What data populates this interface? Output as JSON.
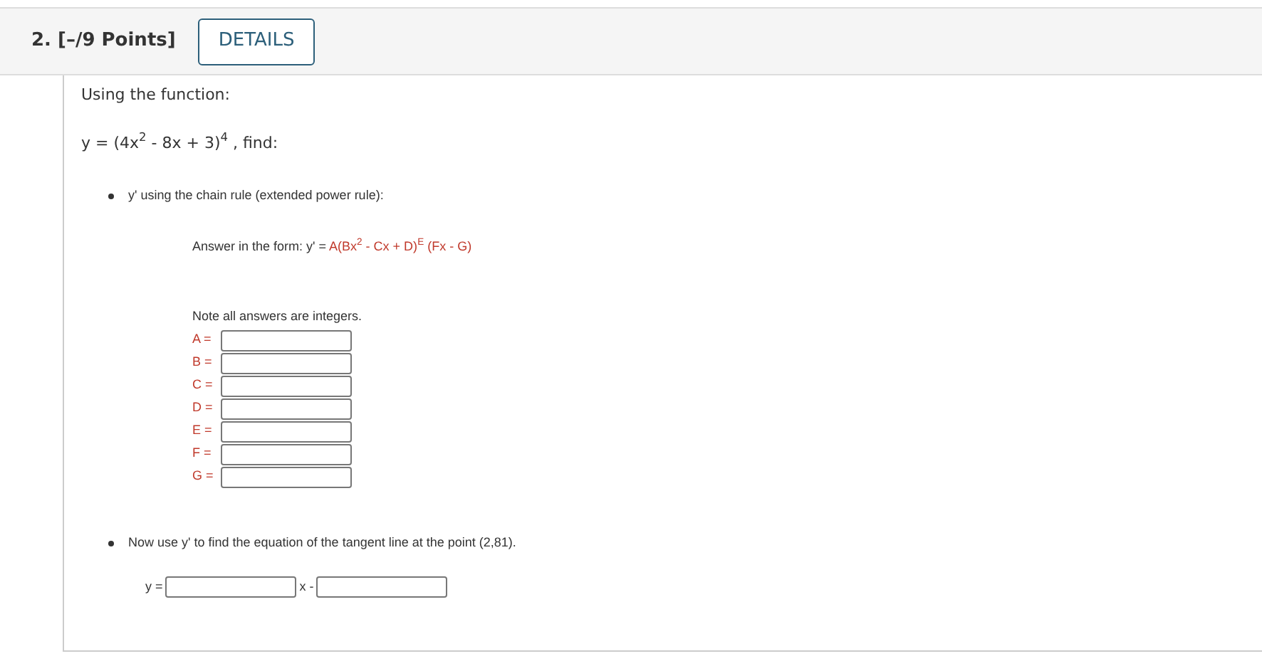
{
  "question": {
    "number": "2.",
    "points": "[–/9 Points]",
    "details_button": "DETAILS"
  },
  "intro": "Using the function:",
  "function": "y = (4x$^{2}$ - 8x + 3)$^{4}$ , find:",
  "parts": [
    {
      "prompt": "y' using the chain rule (extended power rule):",
      "form_label": "Answer in the form: y' = ",
      "form": "A(Bx$^{2}$ - Cx + D)$^{E}$ (Fx - G)",
      "note": "Note all answers are integers.",
      "fields": [
        {
          "label": "A ="
        },
        {
          "label": "B ="
        },
        {
          "label": "C ="
        },
        {
          "label": "D ="
        },
        {
          "label": "E ="
        },
        {
          "label": "F ="
        },
        {
          "label": "G ="
        }
      ]
    },
    {
      "prompt": "Now use y' to find the equation of the tangent line at the point (2,81).",
      "lhs": "y =",
      "middle": "x -"
    }
  ]
}
